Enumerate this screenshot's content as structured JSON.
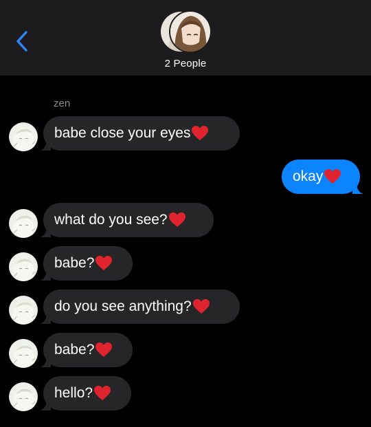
{
  "header": {
    "group_title": "2 People",
    "back_icon": "chevron-left-icon",
    "back_color": "#2f86f6"
  },
  "thread": {
    "sender_name": "zen",
    "messages": [
      {
        "from": "zen",
        "text": "babe close your eyes",
        "emoji": "heart"
      },
      {
        "from": "me",
        "text": "okay",
        "emoji": "heart"
      },
      {
        "from": "zen",
        "text": "what do you see?",
        "emoji": "heart"
      },
      {
        "from": "zen",
        "text": "babe?",
        "emoji": "heart"
      },
      {
        "from": "zen",
        "text": "do you see anything?",
        "emoji": "heart"
      },
      {
        "from": "zen",
        "text": "babe?",
        "emoji": "heart"
      },
      {
        "from": "zen",
        "text": "hello?",
        "emoji": "heart"
      }
    ]
  },
  "colors": {
    "background": "#000000",
    "header_bg": "#1c1c1e",
    "incoming_bubble": "#262628",
    "outgoing_bubble": "#0b84fe",
    "sender_name": "#8e8e93",
    "heart": "#e0242f"
  }
}
